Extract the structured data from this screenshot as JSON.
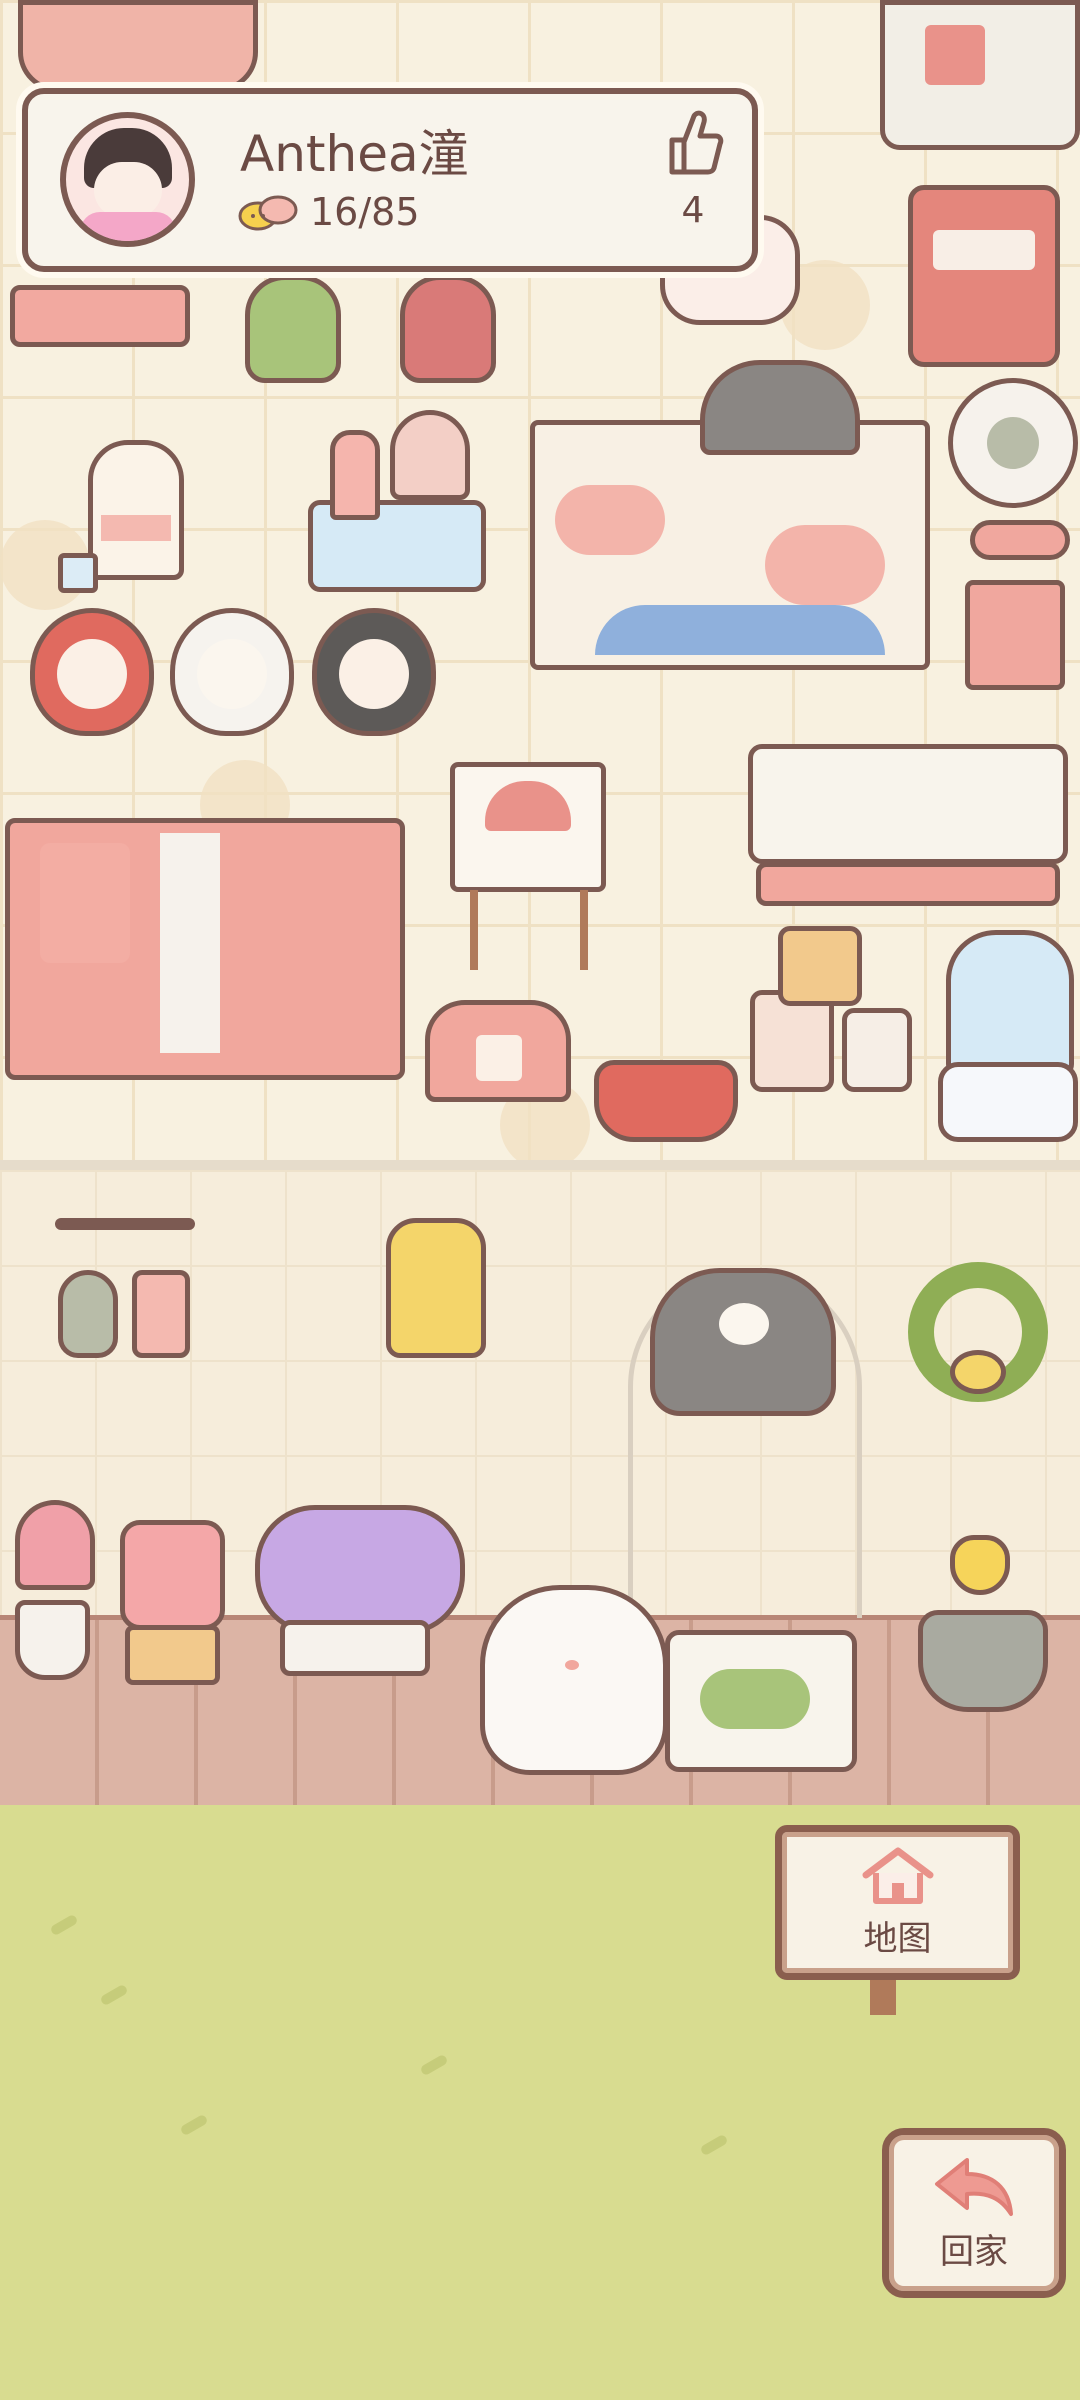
{
  "player": {
    "name": "Anthea潼",
    "visits": "16/85",
    "likes": "4"
  },
  "buttons": {
    "map_label": "地图",
    "home_label": "回家"
  },
  "icons": {
    "like": "thumbs-up-icon",
    "currency": "cat-coin-icon",
    "map": "house-icon",
    "home": "return-arrow-icon"
  },
  "colors": {
    "outline": "#7c5a52",
    "card_bg": "#f8f4ec",
    "grass": "#d8dc90",
    "accent_pink": "#e9928a"
  }
}
